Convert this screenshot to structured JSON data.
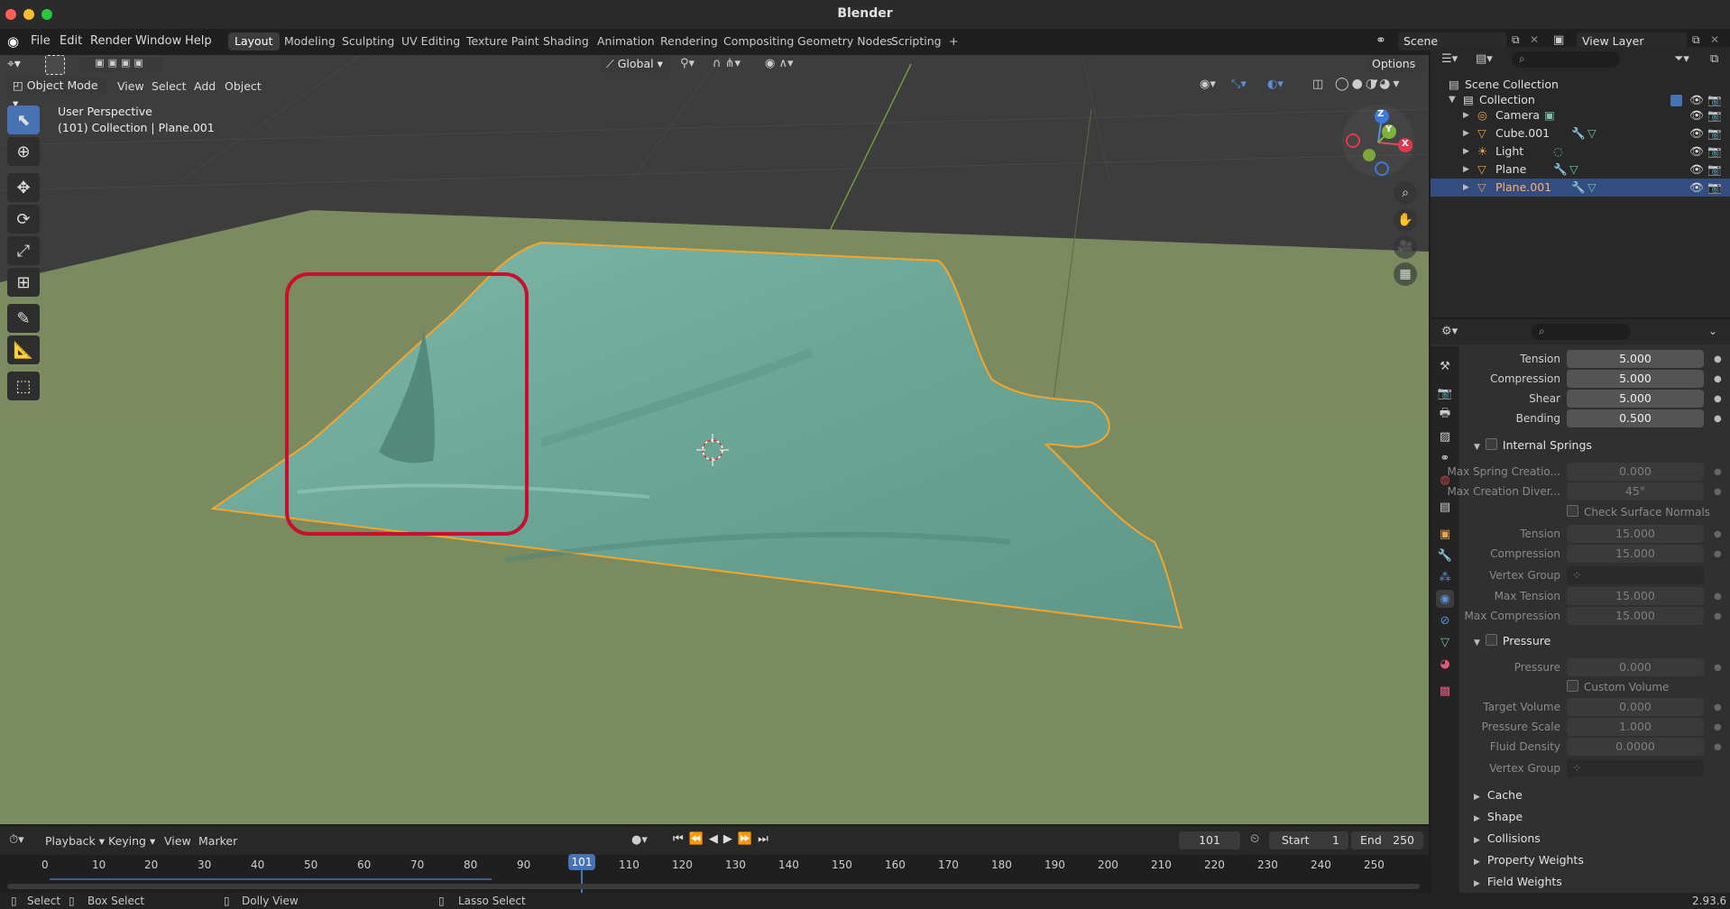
{
  "window": {
    "title": "Blender"
  },
  "menu": [
    "File",
    "Edit",
    "Render",
    "Window",
    "Help"
  ],
  "workspaces": [
    {
      "label": "Layout",
      "active": true
    },
    {
      "label": "Modeling"
    },
    {
      "label": "Sculpting"
    },
    {
      "label": "UV Editing"
    },
    {
      "label": "Texture Paint"
    },
    {
      "label": "Shading"
    },
    {
      "label": "Animation"
    },
    {
      "label": "Rendering"
    },
    {
      "label": "Compositing"
    },
    {
      "label": "Geometry Nodes"
    },
    {
      "label": "Scripting"
    },
    {
      "label": "+"
    }
  ],
  "scene": {
    "name": "Scene",
    "view_layer": "View Layer"
  },
  "viewport": {
    "mode": "Object Mode",
    "header_menus": [
      "View",
      "Select",
      "Add",
      "Object"
    ],
    "transform_orientation": "Global",
    "options_label": "Options",
    "overlay_title": "User Perspective",
    "overlay_subtitle": "(101) Collection | Plane.001",
    "gizmo_axes": {
      "z": "Z",
      "y": "Y",
      "x": "X"
    }
  },
  "outliner": {
    "root": "Scene Collection",
    "collection": "Collection",
    "items": [
      {
        "label": "Camera",
        "type_icon": "camera-icon",
        "selected": false
      },
      {
        "label": "Cube.001",
        "type_icon": "mesh-icon",
        "selected": false
      },
      {
        "label": "Light",
        "type_icon": "light-icon",
        "selected": false
      },
      {
        "label": "Plane",
        "type_icon": "mesh-icon",
        "selected": false
      },
      {
        "label": "Plane.001",
        "type_icon": "mesh-icon",
        "selected": true
      }
    ]
  },
  "properties": {
    "stiffness": [
      {
        "label": "Tension",
        "value": "5.000"
      },
      {
        "label": "Compression",
        "value": "5.000"
      },
      {
        "label": "Shear",
        "value": "5.000"
      },
      {
        "label": "Bending",
        "value": "0.500"
      }
    ],
    "internal_springs": {
      "title": "Internal Springs",
      "max_spring_label": "Max Spring Creatio...",
      "max_spring_value": "0.000",
      "max_diver_label": "Max Creation Diver...",
      "max_diver_value": "45°",
      "check_normals": "Check Surface Normals",
      "tension_label": "Tension",
      "tension_value": "15.000",
      "compression_label": "Compression",
      "compression_value": "15.000",
      "vgroup_label": "Vertex Group",
      "max_tension_label": "Max Tension",
      "max_tension_value": "15.000",
      "max_compression_label": "Max Compression",
      "max_compression_value": "15.000"
    },
    "pressure": {
      "title": "Pressure",
      "pressure_label": "Pressure",
      "pressure_value": "0.000",
      "custom_volume": "Custom Volume",
      "target_volume_label": "Target Volume",
      "target_volume_value": "0.000",
      "pressure_scale_label": "Pressure Scale",
      "pressure_scale_value": "1.000",
      "fluid_density_label": "Fluid Density",
      "fluid_density_value": "0.0000",
      "vgroup_label": "Vertex Group"
    },
    "subpanels": [
      "Cache",
      "Shape",
      "Collisions",
      "Property Weights",
      "Field Weights"
    ]
  },
  "timeline": {
    "menus": [
      "Playback",
      "Keying",
      "View",
      "Marker"
    ],
    "current_frame": "101",
    "start_label": "Start",
    "start_value": "1",
    "end_label": "End",
    "end_value": "250",
    "ticks": [
      "0",
      "10",
      "20",
      "30",
      "40",
      "50",
      "60",
      "70",
      "80",
      "90",
      "110",
      "120",
      "130",
      "140",
      "150",
      "160",
      "170",
      "180",
      "190",
      "200",
      "210",
      "220",
      "230",
      "240",
      "250"
    ]
  },
  "status": {
    "select": "Select",
    "box_select": "Box Select",
    "dolly_view": "Dolly View",
    "lasso_select": "Lasso Select",
    "version": "2.93.6"
  }
}
